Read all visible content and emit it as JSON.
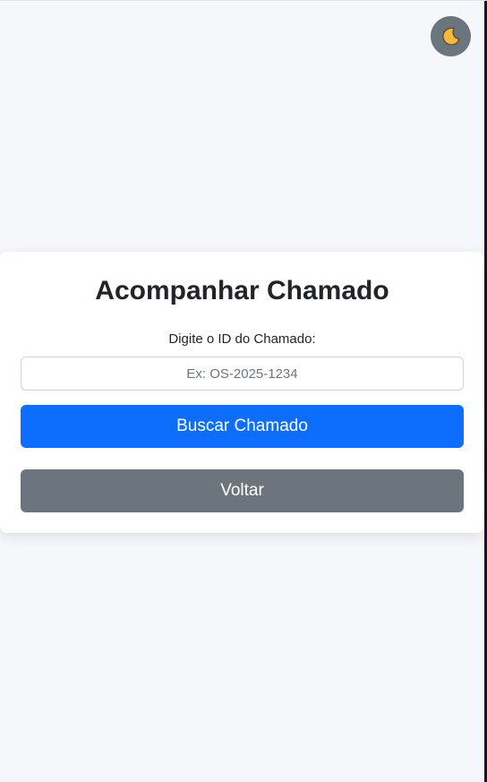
{
  "theme_toggle": {
    "icon": "moon-icon",
    "icon_color": "#f4b93e"
  },
  "card": {
    "title": "Acompanhar Chamado",
    "input_label": "Digite o ID do Chamado:",
    "input_placeholder": "Ex: OS-2025-1234",
    "input_value": "",
    "search_button_label": "Buscar Chamado",
    "back_button_label": "Voltar"
  },
  "colors": {
    "page_background": "#f6f7fa",
    "primary": "#0d6efd",
    "secondary": "#6c757d",
    "toggle_background": "#6c747e"
  }
}
